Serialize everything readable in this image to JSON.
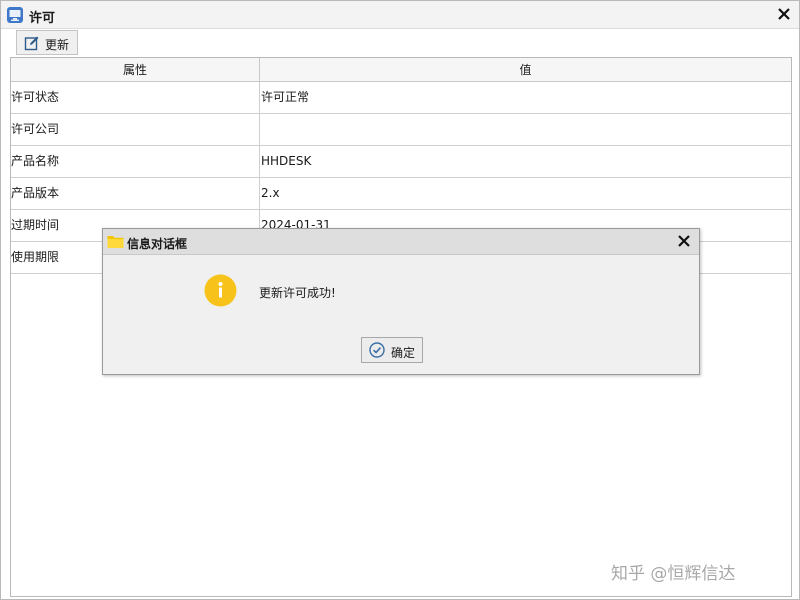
{
  "window": {
    "title": "许可",
    "app_icon": "monitor-icon",
    "close_icon": "close-icon"
  },
  "toolbar": {
    "update_label": "更新",
    "update_icon": "edit-icon"
  },
  "table": {
    "headers": [
      "属性",
      "值"
    ],
    "rows": [
      [
        "许可状态",
        "许可正常"
      ],
      [
        "许可公司",
        ""
      ],
      [
        "产品名称",
        "HHDESK"
      ],
      [
        "产品版本",
        "2.x"
      ],
      [
        "过期时间",
        "2024-01-31"
      ],
      [
        "使用期限",
        ""
      ]
    ]
  },
  "dialog": {
    "title": "信息对话框",
    "title_icon": "folder-icon",
    "message": "更新许可成功!",
    "message_icon": "info-icon",
    "ok_label": "确定",
    "ok_icon": "check-circle-icon",
    "close_icon": "close-icon"
  },
  "watermark": "知乎 @恒辉信达"
}
